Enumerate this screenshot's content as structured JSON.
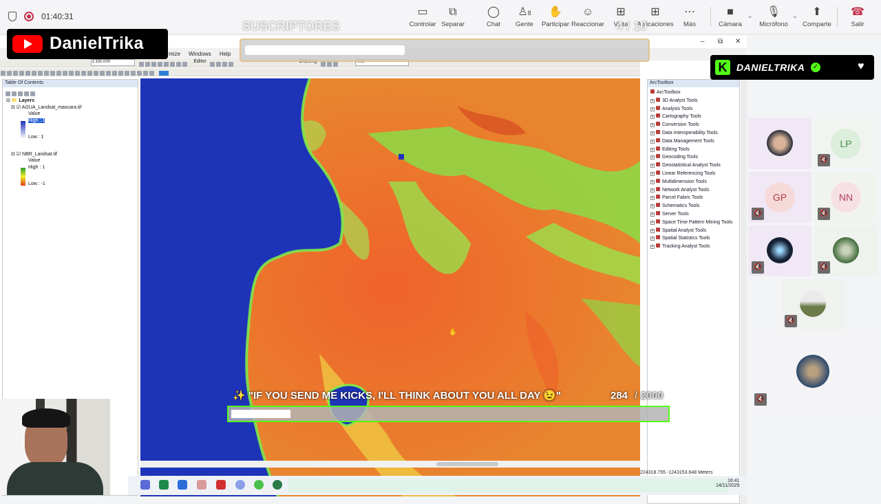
{
  "meeting": {
    "timer": "01:40:31",
    "toolbar": [
      {
        "label": "Controlar",
        "icon": "monitor-icon",
        "glyph": "🖵"
      },
      {
        "label": "Separar",
        "icon": "popout-icon",
        "glyph": "⧉"
      },
      {
        "label": "Chat",
        "icon": "chat-icon",
        "glyph": "💬"
      },
      {
        "label": "Gente",
        "icon": "people-icon",
        "glyph": "👤"
      },
      {
        "label": "Participar",
        "icon": "hand-icon",
        "glyph": "✋"
      },
      {
        "label": "Reaccionar",
        "icon": "smile-icon",
        "glyph": "☺"
      },
      {
        "label": "Vista",
        "icon": "grid-icon",
        "glyph": "⊞"
      },
      {
        "label": "Aplicaciones",
        "icon": "plus-icon",
        "glyph": "⊞"
      },
      {
        "label": "Más",
        "icon": "more-icon",
        "glyph": "⋯"
      },
      {
        "label": "Cámara",
        "icon": "camera-off-icon",
        "glyph": "📷"
      },
      {
        "label": "Micrófono",
        "icon": "mic-off-icon",
        "glyph": "🎙"
      },
      {
        "label": "Comparte",
        "icon": "share-icon",
        "glyph": "⬆"
      },
      {
        "label": "Salir",
        "icon": "hangup-icon",
        "glyph": "☎"
      }
    ],
    "people_count": "8"
  },
  "overlay": {
    "youtube_name": "DanielTrika",
    "kick_name": "DANIELTRIKA",
    "subscribers_label": "SUSCRIPTORES",
    "subscribers_progress": "4 / 10",
    "goal_text": "✨ \"IF YOU SEND ME KICKS, I'LL THINK ABOUT YOU ALL DAY 😉\"",
    "goal_current": "284",
    "goal_total": "/ 2000"
  },
  "arcmap": {
    "menu": [
      "mize",
      "Windows",
      "Help"
    ],
    "scale": "1:100.000",
    "editor_label": "Editor",
    "drawing_label": "Drawing",
    "font_label": "Arial",
    "toc_title": "Table Of Contents",
    "toc": {
      "layers_label": "Layers",
      "layer1": {
        "name": "AGUA_Landsat_mascara.tif",
        "value_label": "Value",
        "high": "High : 1",
        "low": "Low : 1"
      },
      "layer2": {
        "name": "NBR_Landsat.tif",
        "value_label": "Value",
        "high": "High : 1",
        "low": "Low : -1"
      }
    },
    "toolbox_title": "ArcToolbox",
    "toolbox_root": "ArcToolbox",
    "tools": [
      "3D Analyst Tools",
      "Analysis Tools",
      "Cartography Tools",
      "Conversion Tools",
      "Data Interoperability Tools",
      "Data Management Tools",
      "Editing Tools",
      "Geocoding Tools",
      "Geostatistical Analyst Tools",
      "Linear Referencing Tools",
      "Multidimension Tools",
      "Network Analyst Tools",
      "Parcel Fabric Tools",
      "Schematics Tools",
      "Server Tools",
      "Space Time Pattern Mining Tools",
      "Spatial Analyst Tools",
      "Spatial Statistics Tools",
      "Tracking Analyst Tools"
    ],
    "coordinates": "224318.755  -1243153.648 Meters"
  },
  "participants": [
    {
      "type": "photo",
      "muted": false
    },
    {
      "type": "initials",
      "initials": "LP",
      "muted": true
    },
    {
      "type": "initials",
      "initials": "GP",
      "muted": true
    },
    {
      "type": "initials",
      "initials": "NN",
      "muted": true
    },
    {
      "type": "photo",
      "muted": true
    },
    {
      "type": "photo",
      "muted": true
    },
    {
      "type": "photo",
      "muted": true
    },
    {
      "type": "photo",
      "muted": true
    }
  ],
  "clock": {
    "time": "16:41",
    "date": "14/11/2025"
  },
  "colors": {
    "kick_green": "#53fc18",
    "youtube_red": "#ff0000",
    "water_blue": "#1e34b8",
    "nbr_orange": "#e77a2a",
    "nbr_green": "#7fe84a"
  }
}
